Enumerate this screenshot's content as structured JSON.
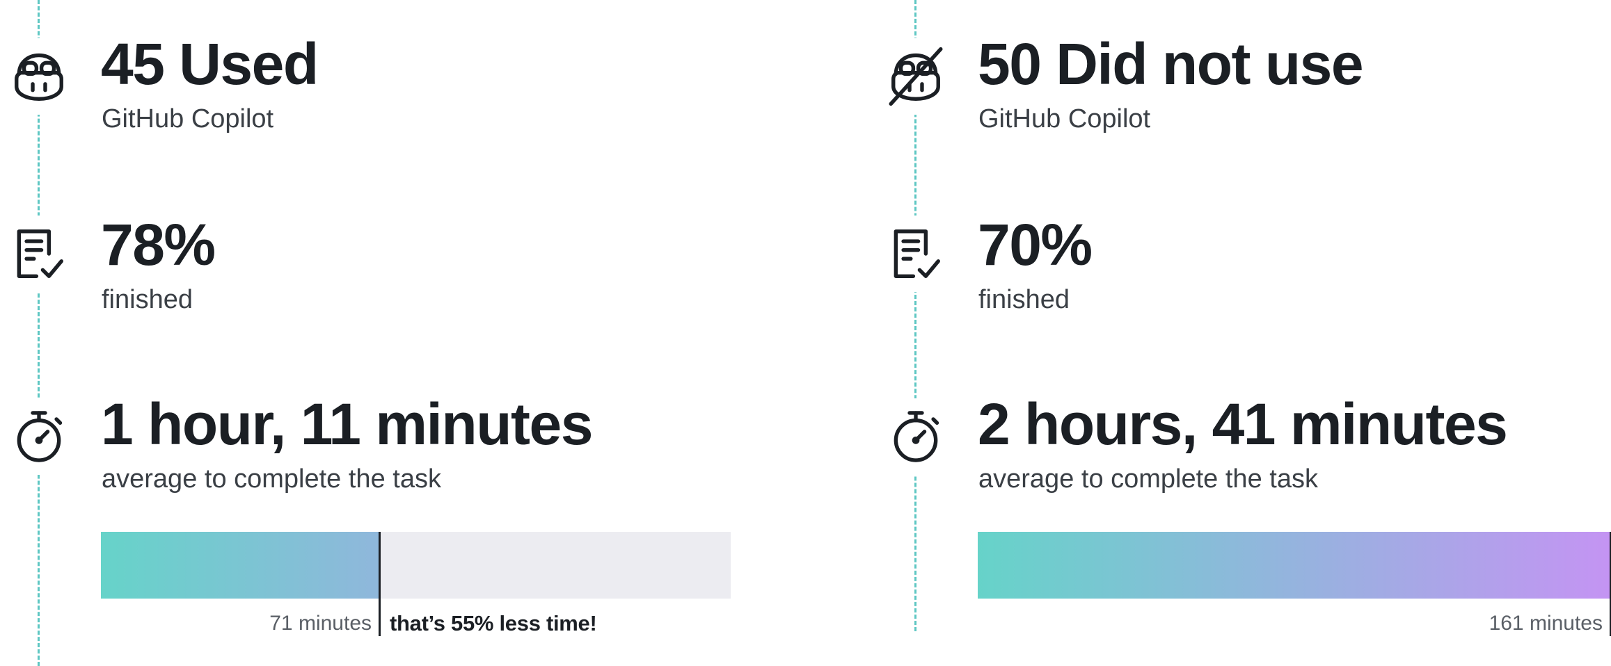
{
  "colors": {
    "rail": "#5ec7c3",
    "bar_start": "#66d3c9",
    "bar_end": "#c494f3",
    "track": "#ececf1",
    "text": "#1b1f24"
  },
  "chart_data": {
    "type": "bar",
    "xlim": [
      0,
      161
    ],
    "series": [
      {
        "value": 71,
        "label": "71 minutes",
        "note": "that’s 55% less time!"
      },
      {
        "value": 161,
        "label": "161 minutes"
      }
    ]
  },
  "left": {
    "group": {
      "headline": "45 Used",
      "caption": "GitHub Copilot",
      "icon": "copilot-icon"
    },
    "finished": {
      "headline": "78%",
      "caption": "finished",
      "icon": "checklist-icon"
    },
    "time": {
      "headline": "1 hour, 11 minutes",
      "caption": "average to complete the task",
      "icon": "stopwatch-icon"
    }
  },
  "right": {
    "group": {
      "headline": "50 Did not use",
      "caption": "GitHub Copilot",
      "icon": "copilot-off-icon"
    },
    "finished": {
      "headline": "70%",
      "caption": "finished",
      "icon": "checklist-icon"
    },
    "time": {
      "headline": "2 hours, 41 minutes",
      "caption": "average to complete the task",
      "icon": "stopwatch-icon"
    }
  }
}
